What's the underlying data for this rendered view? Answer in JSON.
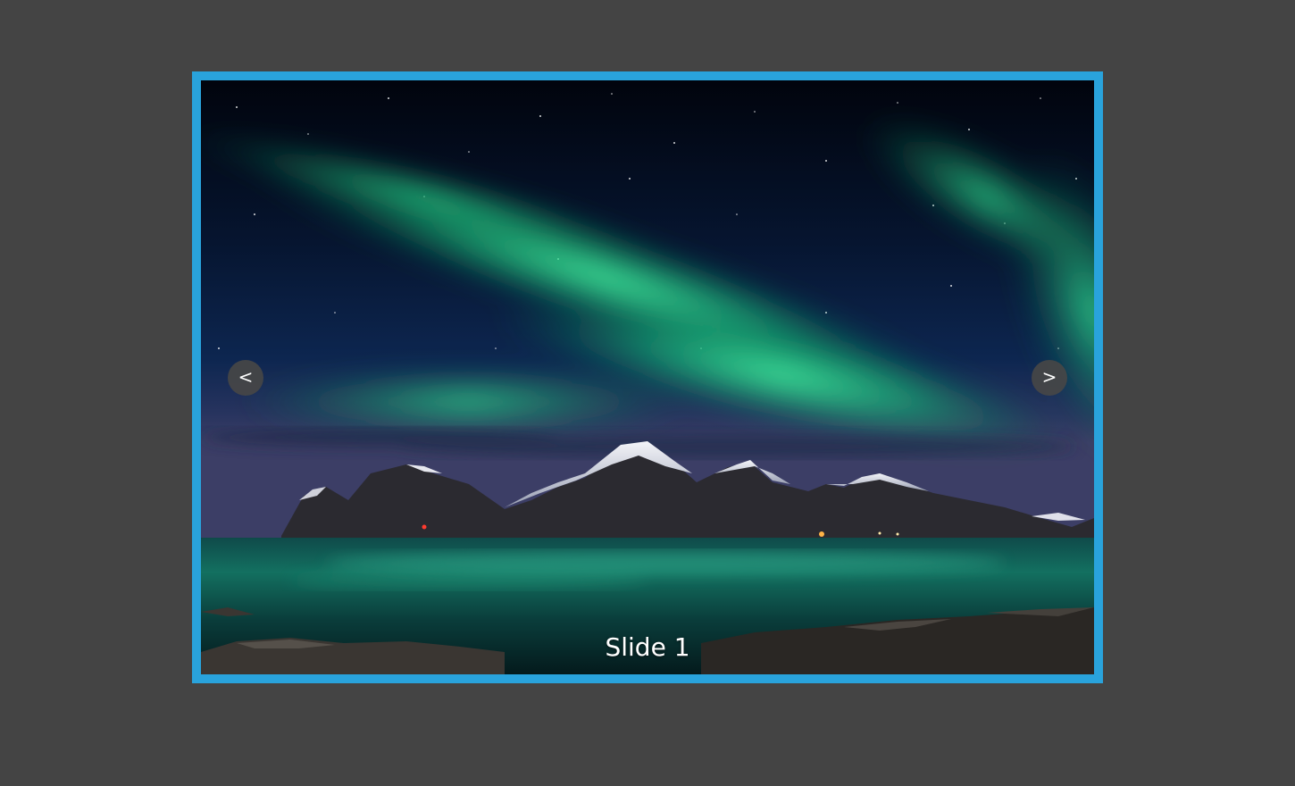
{
  "slider": {
    "border_color": "#29a3dc",
    "prev_label": "<",
    "next_label": ">",
    "caption": "Slide 1",
    "image_icon": "aurora-landscape-photo"
  }
}
